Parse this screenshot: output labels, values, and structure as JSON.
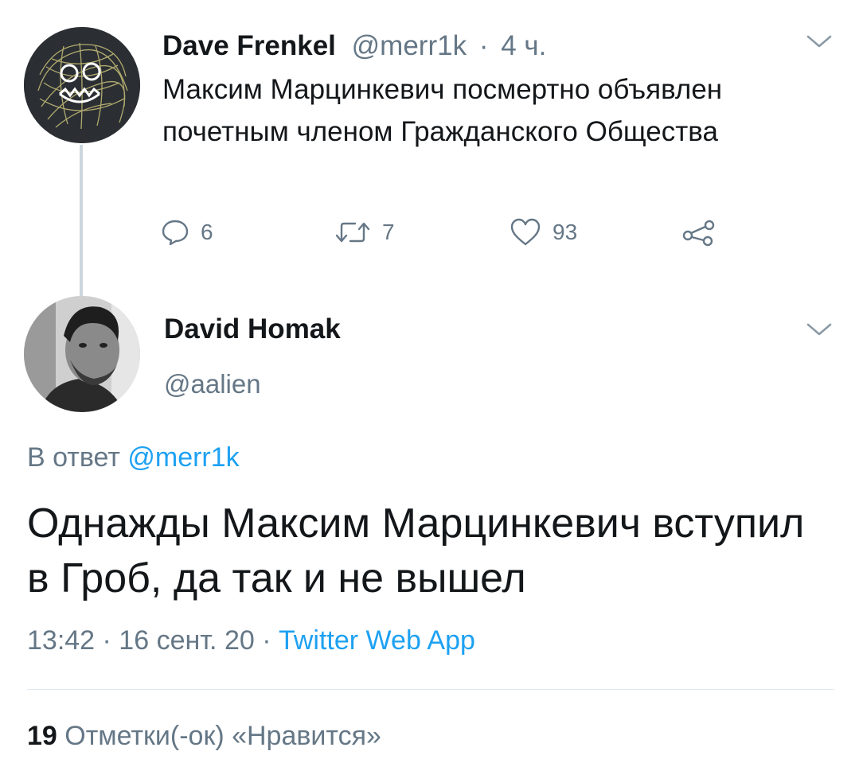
{
  "tweet1": {
    "author_name": "Dave Frenkel",
    "handle": "@merr1k",
    "time": "4 ч.",
    "separator": "·",
    "text": "Максим Марцинкевич посмертно объявлен почетным членом Гражданского Общества",
    "actions": {
      "replies": "6",
      "retweets": "7",
      "likes": "93"
    }
  },
  "tweet2": {
    "author_name": "David Homak",
    "handle": "@aalien",
    "reply_prefix": "В ответ",
    "reply_to": "@merr1k",
    "text": "Однажды Максим Марцинкевич вступил в Гроб, да так и не вышел",
    "timestamp": "13:42 · 16 сент. 20 ·",
    "source": "Twitter Web App",
    "likes_count": "19",
    "likes_label": "Отметки(-ок) «Нравится»"
  },
  "icons": {
    "reply": "reply-icon",
    "retweet": "retweet-icon",
    "like": "heart-icon",
    "share": "share-icon",
    "menu": "chevron-down-icon"
  },
  "colors": {
    "link": "#1da1f2",
    "muted": "#657786",
    "text": "#14171a",
    "thread_line": "#ccd6dd"
  }
}
